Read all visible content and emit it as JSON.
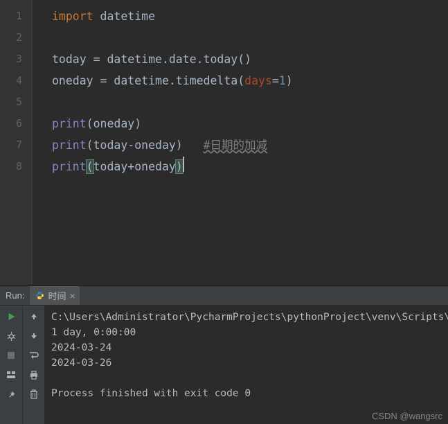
{
  "editor": {
    "lines": [
      "1",
      "2",
      "3",
      "4",
      "5",
      "6",
      "7",
      "8"
    ],
    "code": {
      "l1_kw": "import",
      "l1_rest": " datetime",
      "l3": "today = datetime.date.today()",
      "l4_a": "oneday = datetime.timedelta(",
      "l4_param": "days",
      "l4_eq": "=",
      "l4_num": "1",
      "l4_b": ")",
      "l6_fn": "print",
      "l6_rest": "(oneday)",
      "l7_fn": "print",
      "l7_rest": "(today-oneday)   ",
      "l7_comment": "#日期的加减",
      "l8_fn": "print",
      "l8_open": "(",
      "l8_mid": "today+oneday",
      "l8_close": ")"
    }
  },
  "run": {
    "label": "Run:",
    "tab_name": "时间"
  },
  "console": {
    "l1": "C:\\Users\\Administrator\\PycharmProjects\\pythonProject\\venv\\Scripts\\python",
    "l2": "1 day, 0:00:00",
    "l3": "2024-03-24",
    "l4": "2024-03-26",
    "l5": "",
    "l6": "Process finished with exit code 0"
  },
  "watermark": "CSDN @wangsrc"
}
